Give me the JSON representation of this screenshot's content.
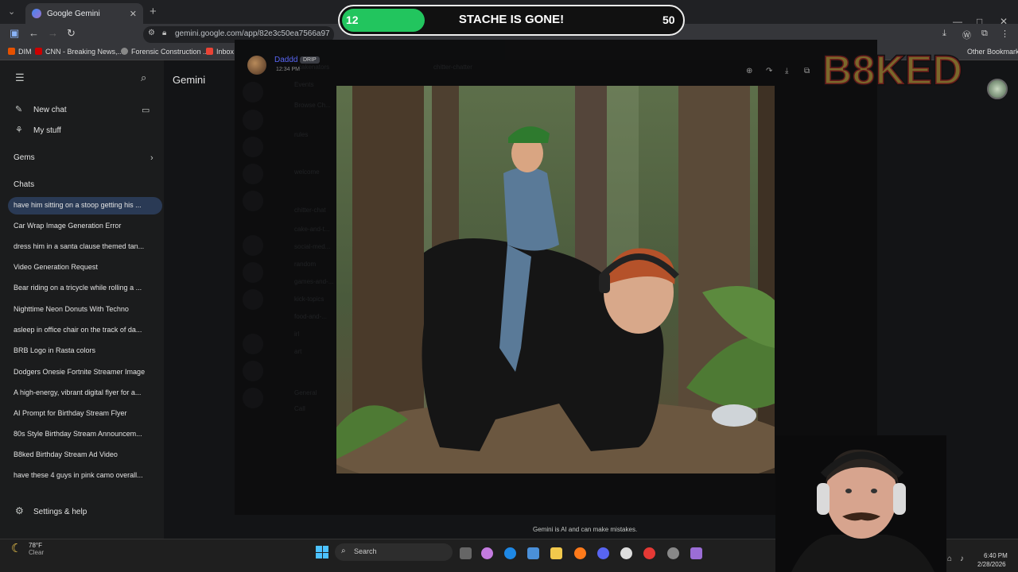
{
  "browser": {
    "tab_title": "Google Gemini",
    "tab_close": "✕",
    "new_tab": "+",
    "url": "gemini.google.com/app/82e3c50ea7566a97",
    "bookmarks": [
      {
        "label": "DIM",
        "color": "#e65100"
      },
      {
        "label": "CNN - Breaking News,...",
        "color": "#cc0000"
      },
      {
        "label": "Forensic Construction ...",
        "color": "#888888"
      },
      {
        "label": "Inbox",
        "color": "#ea4335"
      }
    ],
    "other_bookmarks": "Other Bookmarks",
    "window_controls": {
      "minimize": "—",
      "maximize": "□",
      "close": "✕"
    },
    "nav": {
      "back": "←",
      "forward": "→",
      "reload": "↻"
    }
  },
  "gemini": {
    "title": "Gemini",
    "menu_icon": "☰",
    "search_icon": "⌕",
    "new_chat": "New chat",
    "my_stuff": "My stuff",
    "gems": "Gems",
    "chats_heading": "Chats",
    "chats": [
      "have him sitting on a stoop getting his ...",
      "Car Wrap Image Generation Error",
      "dress him in a santa clause themed tan...",
      "Video Generation Request",
      "Bear riding on a tricycle while rolling a ...",
      "Nighttime Neon Donuts With Techno",
      "asleep in office chair on the track of da...",
      "BRB Logo in Rasta colors",
      "Dodgers Onesie Fortnite Streamer Image",
      "A high-energy, vibrant digital flyer for a...",
      "AI Prompt for Birthday Stream Flyer",
      "80s Style Birthday Stream Announcem...",
      "B8ked Birthday Stream Ad Video",
      "have these 4 guys in pink camo overall..."
    ],
    "settings": "Settings & help",
    "disclaimer": "Gemini is AI and can make mistakes."
  },
  "discord": {
    "username": "Daddd",
    "badge": "DRIP",
    "timestamp": "12:34 PM",
    "channels": [
      "chitter-chatter",
      "cakenators",
      "Events",
      "Browse Ch...",
      "rules",
      "welcome",
      "chitter-chat",
      "cake-and-t...",
      "social-med...",
      "random",
      "games-and-...",
      "kick-topics",
      "food-and-...",
      "irl",
      "art",
      "General",
      "Call"
    ]
  },
  "goal": {
    "current": "12",
    "title": "STACHE IS GONE!",
    "max": "50",
    "progress_fraction": 0.24,
    "color": "#22c55e"
  },
  "logo_text": "B8KED",
  "taskbar": {
    "weather_temp": "78°F",
    "weather_desc": "Clear",
    "search": "Search",
    "time": "6:40 PM",
    "date": "2/28/2026"
  }
}
